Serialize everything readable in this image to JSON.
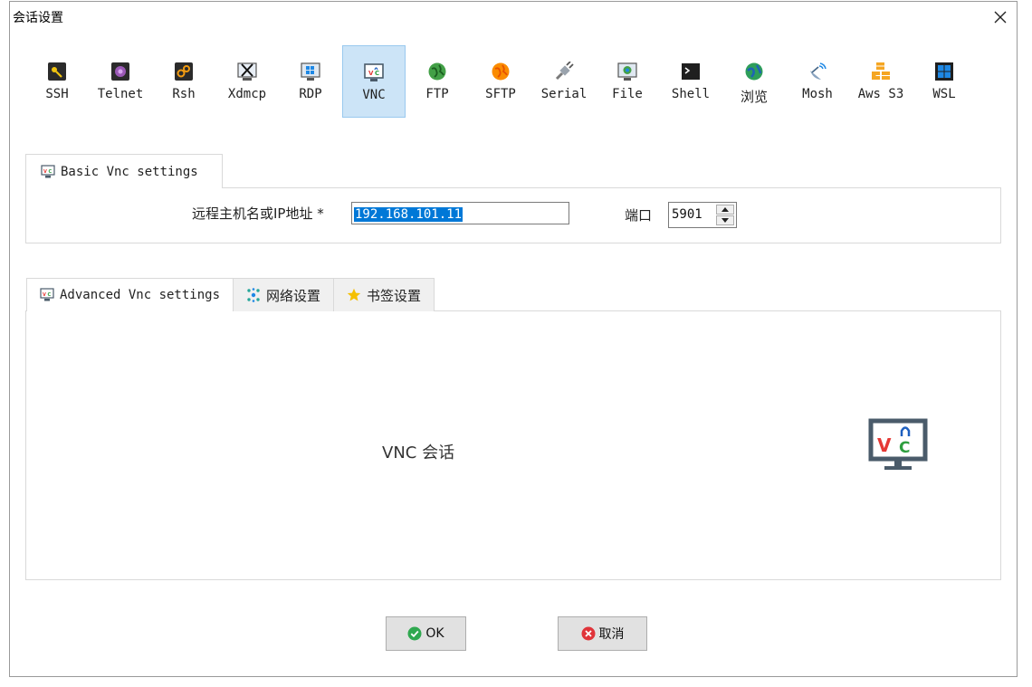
{
  "window": {
    "title": "会话设置"
  },
  "session_types": [
    {
      "label": "SSH",
      "icon": "key-icon"
    },
    {
      "label": "Telnet",
      "icon": "telnet-icon"
    },
    {
      "label": "Rsh",
      "icon": "rsh-icon"
    },
    {
      "label": "Xdmcp",
      "icon": "x-window-icon"
    },
    {
      "label": "RDP",
      "icon": "windows-monitor-icon"
    },
    {
      "label": "VNC",
      "icon": "vnc-icon",
      "selected": true
    },
    {
      "label": "FTP",
      "icon": "globe-green-icon"
    },
    {
      "label": "SFTP",
      "icon": "globe-orange-icon"
    },
    {
      "label": "Serial",
      "icon": "serial-plug-icon"
    },
    {
      "label": "File",
      "icon": "file-monitor-icon"
    },
    {
      "label": "Shell",
      "icon": "terminal-icon"
    },
    {
      "label": "浏览",
      "icon": "globe-browser-icon"
    },
    {
      "label": "Mosh",
      "icon": "satellite-icon"
    },
    {
      "label": "Aws S3",
      "icon": "aws-cubes-icon"
    },
    {
      "label": "WSL",
      "icon": "windows-icon"
    }
  ],
  "basic": {
    "tab_label": "Basic Vnc settings",
    "host_label": "远程主机名或IP地址 *",
    "host_value": "192.168.101.11",
    "port_label": "端口",
    "port_value": "5901"
  },
  "advanced": {
    "tabs": [
      {
        "label": "Advanced Vnc settings",
        "icon": "vnc-icon"
      },
      {
        "label": "网络设置",
        "icon": "network-icon"
      },
      {
        "label": "书签设置",
        "icon": "star-icon"
      }
    ],
    "caption": "VNC 会话"
  },
  "buttons": {
    "ok": "OK",
    "cancel": "取消"
  },
  "colors": {
    "selected_bg": "#cce4f7",
    "selection_blue": "#0078d7",
    "ok_green": "#2fa84f",
    "cancel_red": "#e0343a"
  }
}
